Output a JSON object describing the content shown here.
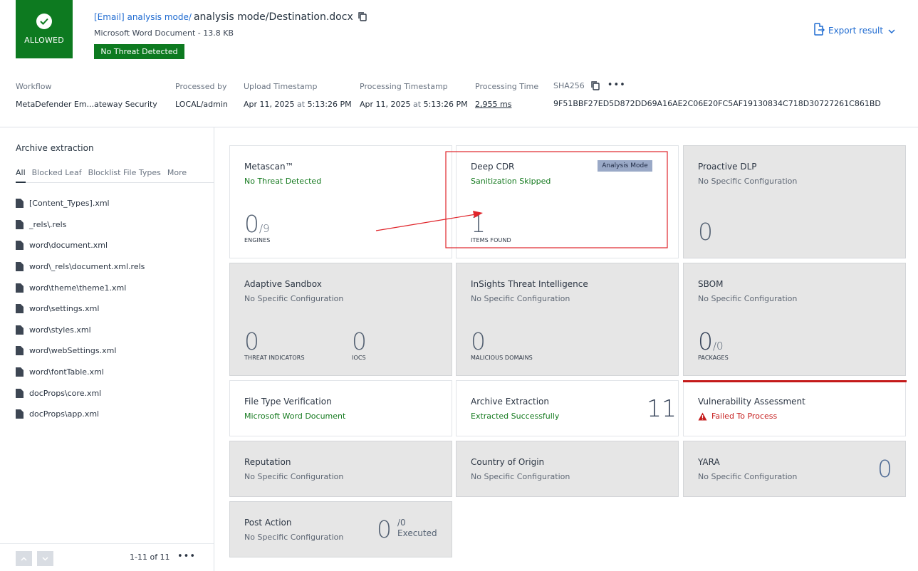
{
  "verdict": {
    "label": "ALLOWED",
    "icon": "check-circle-icon"
  },
  "file": {
    "path_prefix": "[Email] analysis mode/",
    "name": "analysis mode/Destination.docx",
    "type_size": "Microsoft Word Document - 13.8 KB",
    "status": "No Threat Detected"
  },
  "export": {
    "label": "Export result"
  },
  "meta": {
    "workflow": {
      "label": "Workflow",
      "value": "MetaDefender Em...ateway Security"
    },
    "processed_by": {
      "label": "Processed by",
      "value": "LOCAL/admin"
    },
    "upload": {
      "label": "Upload Timestamp",
      "date": "Apr 11, 2025",
      "at": "at",
      "time": "5:13:26 PM"
    },
    "processing": {
      "label": "Processing Timestamp",
      "date": "Apr 11, 2025",
      "at": "at",
      "time": "5:13:26 PM"
    },
    "processing_time": {
      "label": "Processing Time",
      "value": "2,955 ms"
    },
    "sha256": {
      "label": "SHA256",
      "value": "9F51BBF27ED5D872DD69A16AE2C06E20FC5AF19130834C718D30727261C861BD"
    }
  },
  "sidebar": {
    "title": "Archive extraction",
    "tabs": [
      "All",
      "Blocked Leaf",
      "Blocklist File Types",
      "More"
    ],
    "files": [
      "[Content_Types].xml",
      "_rels\\.rels",
      "word\\document.xml",
      "word\\_rels\\document.xml.rels",
      "word\\theme\\theme1.xml",
      "word\\settings.xml",
      "word\\styles.xml",
      "word\\webSettings.xml",
      "word\\fontTable.xml",
      "docProps\\core.xml",
      "docProps\\app.xml"
    ],
    "pagination": "1-11 of 11"
  },
  "cards": {
    "metascan": {
      "title": "Metascan™",
      "status": "No Threat Detected",
      "value": "0",
      "denom": "/9",
      "caption": "ENGINES"
    },
    "deep_cdr": {
      "title": "Deep CDR",
      "status": "Sanitization Skipped",
      "badge": "Analysis Mode",
      "value": "1",
      "caption": "ITEMS FOUND"
    },
    "proactive_dlp": {
      "title": "Proactive DLP",
      "status": "No Specific Configuration",
      "value": "0"
    },
    "adaptive_sandbox": {
      "title": "Adaptive Sandbox",
      "status": "No Specific Configuration",
      "value1": "0",
      "caption1": "THREAT INDICATORS",
      "value2": "0",
      "caption2": "IOCS"
    },
    "insights": {
      "title": "InSights Threat Intelligence",
      "status": "No Specific Configuration",
      "value": "0",
      "caption": "MALICIOUS DOMAINS"
    },
    "sbom": {
      "title": "SBOM",
      "status": "No Specific Configuration",
      "value": "0",
      "denom": "/0",
      "caption": "PACKAGES"
    },
    "file_type": {
      "title": "File Type Verification",
      "status": "Microsoft Word Document"
    },
    "archive": {
      "title": "Archive Extraction",
      "status": "Extracted Successfully",
      "value": "11"
    },
    "vulnerability": {
      "title": "Vulnerability Assessment",
      "status": "Failed To Process"
    },
    "reputation": {
      "title": "Reputation",
      "status": "No Specific Configuration"
    },
    "country": {
      "title": "Country of Origin",
      "status": "No Specific Configuration"
    },
    "yara": {
      "title": "YARA",
      "status": "No Specific Configuration",
      "value": "0"
    },
    "post_action": {
      "title": "Post Action",
      "status": "No Specific Configuration",
      "value": "0",
      "denom": "/0",
      "executed": "Executed"
    }
  },
  "colors": {
    "allowed_green": "#0d7a20",
    "link_blue": "#1f6bd1",
    "alert_red": "#c41a1a",
    "annotation_red": "#e0252b"
  }
}
